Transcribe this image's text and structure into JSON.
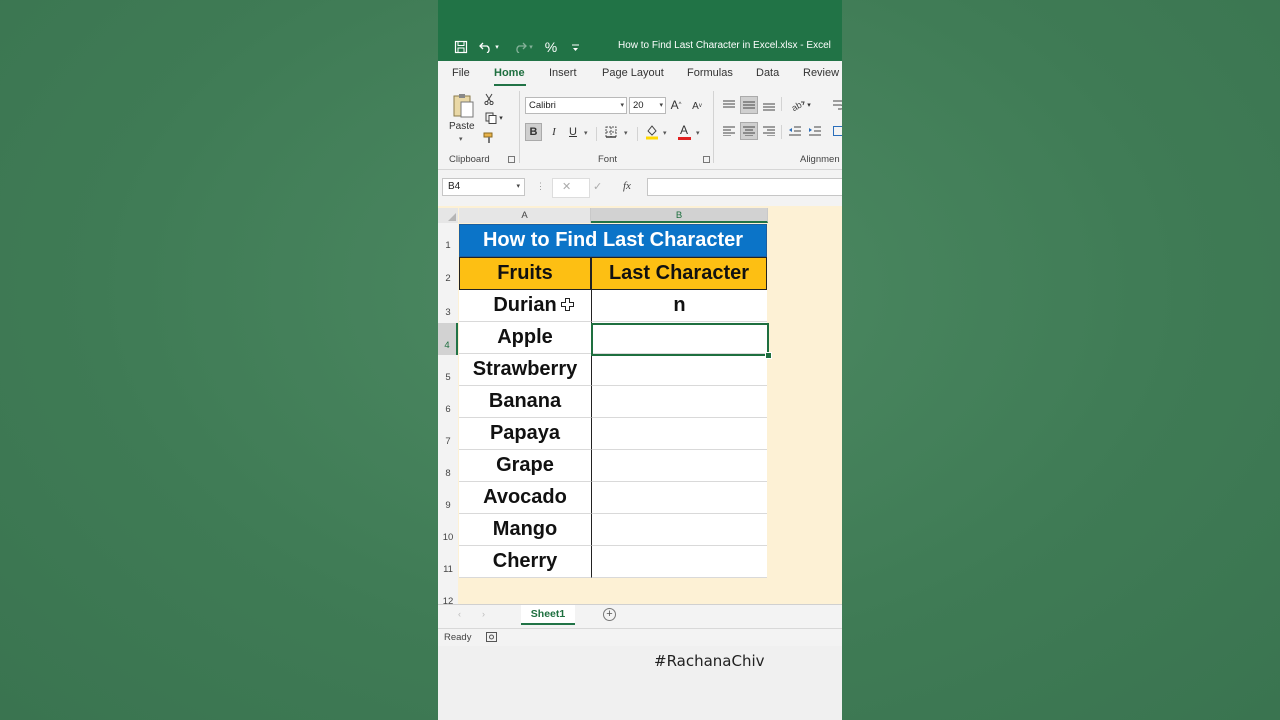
{
  "titlebar": {
    "undo_icon": "undo-icon",
    "redo_icon": "redo-icon",
    "percent_label": "%",
    "window_title": "How to Find Last Character in Excel.xlsx  -  Excel"
  },
  "tabs": [
    "File",
    "Home",
    "Insert",
    "Page Layout",
    "Formulas",
    "Data",
    "Review"
  ],
  "ribbon": {
    "paste_label": "Paste",
    "clipboard_label": "Clipboard",
    "font_name": "Calibri",
    "font_size": "20",
    "font_label": "Font",
    "alignment_label": "Alignmen",
    "bold": "B",
    "italic": "I",
    "underline": "U",
    "grow_font": "A",
    "shrink_font": "A",
    "font_color_letter": "A",
    "font_color": "#e02020",
    "fill_color": "#ffd800"
  },
  "formula_bar": {
    "name_box": "B4",
    "cancel": "✕",
    "enter": "✓",
    "fx": "fx",
    "formula": ""
  },
  "grid": {
    "columns": [
      "A",
      "B"
    ],
    "rows": [
      "1",
      "2",
      "3",
      "4",
      "5",
      "6",
      "7",
      "8",
      "9",
      "10",
      "11",
      "12"
    ],
    "title": "How to Find Last Character",
    "headers": [
      "Fruits",
      "Last Character"
    ],
    "fruits": [
      "Durian",
      "Apple",
      "Strawberry",
      "Banana",
      "Papaya",
      "Grape",
      "Avocado",
      "Mango",
      "Cherry"
    ],
    "last_chars": [
      "n",
      "",
      "",
      "",
      "",
      "",
      "",
      "",
      ""
    ],
    "selected_cell": "B4",
    "title_color": "#0b74c8",
    "header_color": "#fdbf13"
  },
  "sheet_tabs": [
    "Sheet1"
  ],
  "status": {
    "ready": "Ready"
  },
  "overlay": {
    "hashtag": "#RachanaChiv"
  }
}
